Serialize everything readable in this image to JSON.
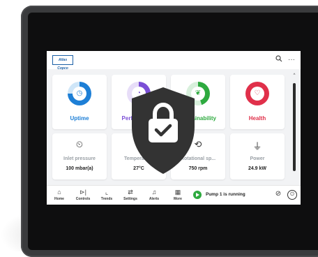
{
  "brand": {
    "logo_text": "Atlas Copco"
  },
  "header": {
    "search_icon": "search-icon",
    "more_icon": "more-icon"
  },
  "top_cards": [
    {
      "label": "Uptime",
      "icon": "clock-icon",
      "color": "#1d7fd6",
      "track": "#cfe6f8"
    },
    {
      "label": "Performance",
      "icon": "gauge-icon",
      "color": "#7b4fd6",
      "track": "#e7ddf8"
    },
    {
      "label": "Sustainability",
      "icon": "leaf-icon",
      "color": "#2eaa3f",
      "track": "#d8f0dc"
    },
    {
      "label": "Health",
      "icon": "heart-icon",
      "color": "#e0304a",
      "track": "#f9d4da"
    }
  ],
  "bottom_cards": [
    {
      "label": "Inlet pressure",
      "value": "100 mbar(a)",
      "icon": "gauge-icon"
    },
    {
      "label": "Temperature",
      "value": "27°C",
      "icon": "thermometer-icon"
    },
    {
      "label": "Rotational sp...",
      "value": "750 rpm",
      "icon": "speed-icon"
    },
    {
      "label": "Power",
      "value": "24.9 kW",
      "icon": "plug-icon"
    }
  ],
  "nav": [
    {
      "label": "Home",
      "icon": "home-icon"
    },
    {
      "label": "Controls",
      "icon": "controls-icon"
    },
    {
      "label": "Trends",
      "icon": "trends-icon"
    },
    {
      "label": "Settings",
      "icon": "settings-icon"
    },
    {
      "label": "Alerts",
      "icon": "bell-icon"
    },
    {
      "label": "More",
      "icon": "grid-icon"
    }
  ],
  "status": {
    "text": "Pump 1 is running",
    "color": "#2eaa3f"
  },
  "overlay": {
    "icon": "lock-shield-icon",
    "color": "#333333"
  }
}
